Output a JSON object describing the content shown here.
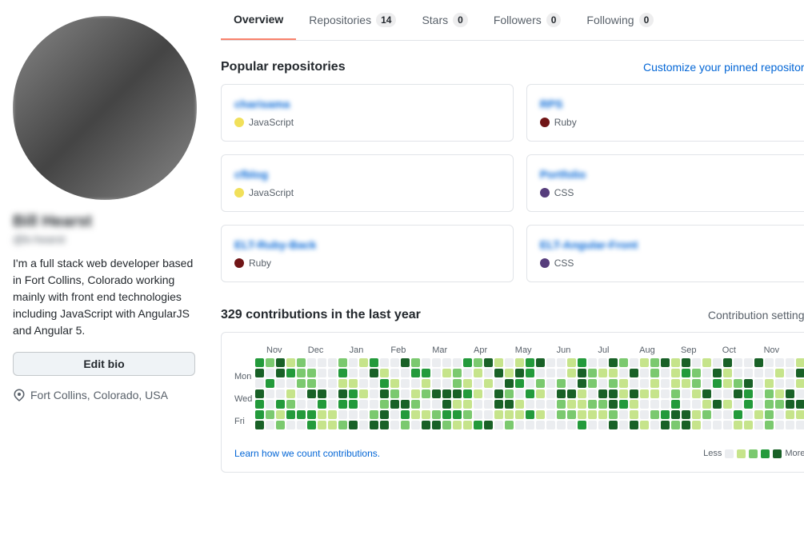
{
  "sidebar": {
    "user_name": "Bill Hearst",
    "user_handle": "@b-hearst",
    "bio": "I'm a full stack web developer based in Fort Collins, Colorado working mainly with front end technologies including JavaScript with AngularJS and Angular 5.",
    "edit_bio_label": "Edit bio",
    "location": "Fort Collins, Colorado, USA"
  },
  "tabs": [
    {
      "label": "Overview",
      "badge": null,
      "active": true
    },
    {
      "label": "Repositories",
      "badge": "14",
      "active": false
    },
    {
      "label": "Stars",
      "badge": "0",
      "active": false
    },
    {
      "label": "Followers",
      "badge": "0",
      "active": false
    },
    {
      "label": "Following",
      "badge": "0",
      "active": false
    }
  ],
  "popular_repos": {
    "title": "Popular repositories",
    "customize_label": "Customize your pinned repositories",
    "repos": [
      {
        "name": "charisama",
        "language": "JavaScript",
        "lang_color": "#f1e05a"
      },
      {
        "name": "RPS",
        "language": "Ruby",
        "lang_color": "#701516"
      },
      {
        "name": "cfblog",
        "language": "JavaScript",
        "lang_color": "#f1e05a"
      },
      {
        "name": "Portfolio",
        "language": "CSS",
        "lang_color": "#563d7c"
      },
      {
        "name": "ELT-Ruby-Back",
        "language": "Ruby",
        "lang_color": "#701516"
      },
      {
        "name": "ELT-Angular-Front",
        "language": "CSS",
        "lang_color": "#563d7c"
      }
    ]
  },
  "contributions": {
    "title": "329 contributions in the last year",
    "settings_label": "Contribution settings ▾",
    "months": [
      "Nov",
      "Dec",
      "Jan",
      "Feb",
      "Mar",
      "Apr",
      "May",
      "Jun",
      "Jul",
      "Aug",
      "Sep",
      "Oct",
      "Nov"
    ],
    "day_labels": [
      "Mon",
      "Wed",
      "Fri"
    ],
    "learn_link": "Learn how we count contributions.",
    "legend_less": "Less",
    "legend_more": "More"
  }
}
